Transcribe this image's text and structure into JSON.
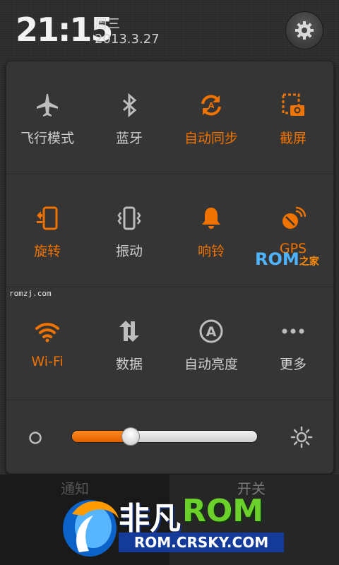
{
  "status": {
    "time": "21:15",
    "weekday": "周三",
    "date": "2013.3.27"
  },
  "toggles": [
    {
      "label": "飞行模式",
      "icon": "airplane-icon",
      "on": false
    },
    {
      "label": "蓝牙",
      "icon": "bluetooth-icon",
      "on": false
    },
    {
      "label": "自动同步",
      "icon": "sync-icon",
      "on": true
    },
    {
      "label": "截屏",
      "icon": "screenshot-icon",
      "on": true
    },
    {
      "label": "旋转",
      "icon": "rotate-icon",
      "on": true
    },
    {
      "label": "振动",
      "icon": "vibrate-icon",
      "on": false
    },
    {
      "label": "响铃",
      "icon": "bell-icon",
      "on": true
    },
    {
      "label": "GPS",
      "icon": "gps-icon",
      "on": true
    },
    {
      "label": "Wi-Fi",
      "icon": "wifi-icon",
      "on": true
    },
    {
      "label": "数据",
      "icon": "data-icon",
      "on": false
    },
    {
      "label": "自动亮度",
      "icon": "auto-brightness-icon",
      "on": false
    },
    {
      "label": "更多",
      "icon": "more-icon",
      "on": false
    }
  ],
  "brightness": {
    "level": 0.32
  },
  "bottom_tabs": {
    "left": "通知",
    "right": "开关"
  },
  "watermarks": {
    "small": "romzj.com",
    "rom_logo": "ROM",
    "rom_logo_suffix": "之家",
    "big_cn": "非凡",
    "big_rom": "ROM",
    "big_url": "ROM.CRSKY.COM"
  },
  "colors": {
    "accent": "#f07300",
    "inactive": "#bdbdbd"
  }
}
